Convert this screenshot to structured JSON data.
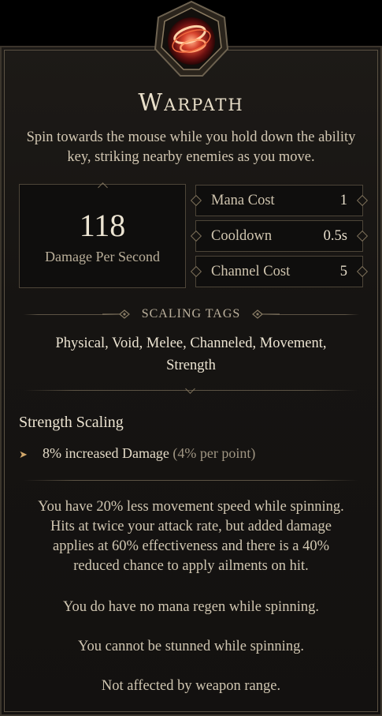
{
  "ability": {
    "name": "Warpath",
    "description": "Spin towards the mouse while you hold down the ability key, striking nearby enemies as you move."
  },
  "dps": {
    "value": "118",
    "label": "Damage Per Second"
  },
  "stats": [
    {
      "label": "Mana Cost",
      "value": "1"
    },
    {
      "label": "Cooldown",
      "value": "0.5s"
    },
    {
      "label": "Channel Cost",
      "value": "5"
    }
  ],
  "scaling": {
    "header": "SCALING TAGS",
    "tags_line1": "Physical, Void, Melee, Channeled, Movement,",
    "tags_line2": "Strength"
  },
  "strength_scaling": {
    "title": "Strength Scaling",
    "bonus": "8% increased Damage",
    "bonus_extra": "(4% per point)"
  },
  "notes": {
    "p1_l1": "You have 20% less movement speed while spinning.",
    "p1_l2": "Hits at twice your attack rate, but added damage",
    "p1_l3": "applies at 60% effectiveness and there is a 40%",
    "p1_l4": "reduced chance to apply ailments on hit.",
    "p2": "You do have no mana regen while spinning.",
    "p3": "You cannot be stunned while spinning.",
    "p4": "Not affected by weapon range."
  },
  "colors": {
    "accent": "#c0392b",
    "text": "#d2c7b2",
    "border": "#4d4538"
  },
  "icons": {
    "ability": "warpath-spin-icon"
  }
}
